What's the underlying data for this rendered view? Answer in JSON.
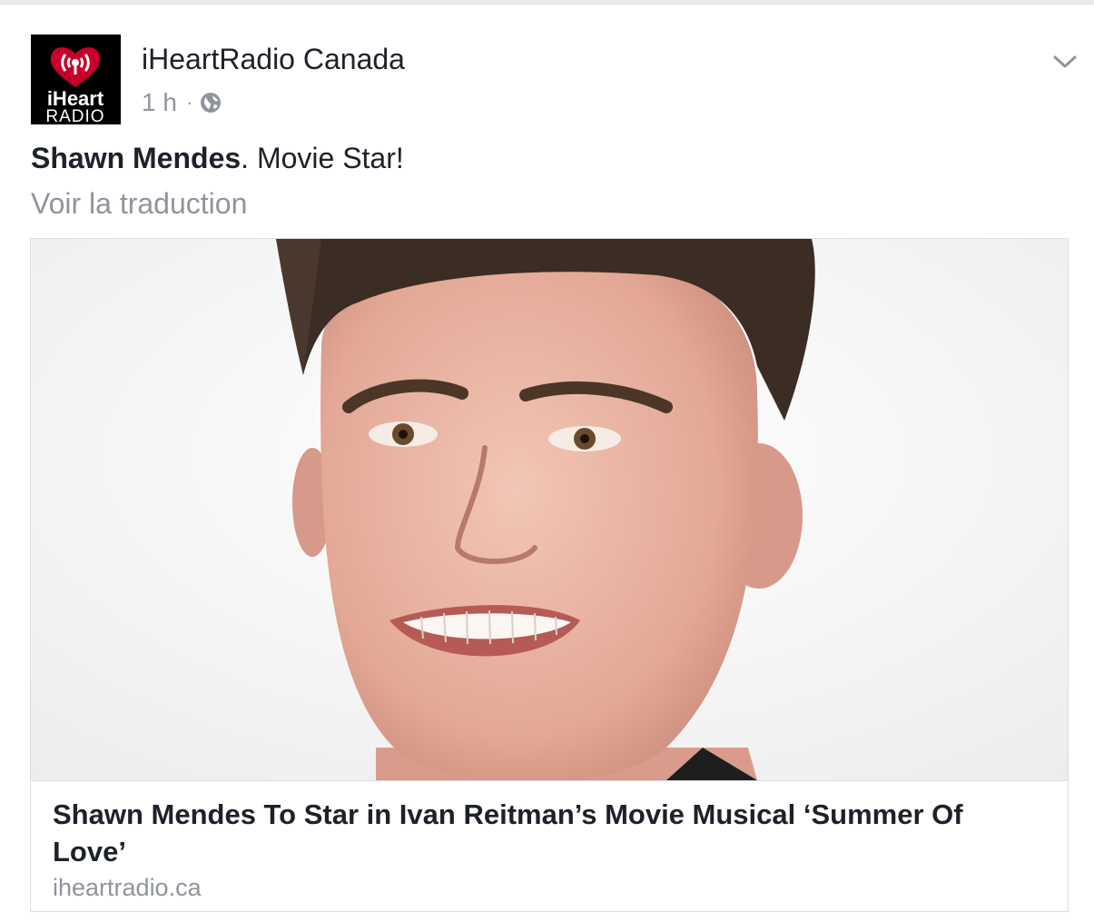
{
  "post": {
    "author": "iHeartRadio Canada",
    "time": "1 h",
    "separator": "·",
    "privacy_icon": "globe-icon",
    "menu_icon": "chevron-down-icon",
    "text_mention": "Shawn Mendes",
    "text_rest": ". Movie Star!",
    "translate_label": "Voir la traduction"
  },
  "avatar": {
    "logo_line1": "iHeart",
    "logo_line2": "RADIO",
    "brand_color": "#c6002b"
  },
  "link": {
    "title": "Shawn Mendes To Star in Ivan Reitman’s Movie Musical ‘Summer Of Love’",
    "domain": "iheartradio.ca"
  },
  "colors": {
    "background": "#e9ebee",
    "text_primary": "#1d2129",
    "text_secondary": "#90949c"
  }
}
